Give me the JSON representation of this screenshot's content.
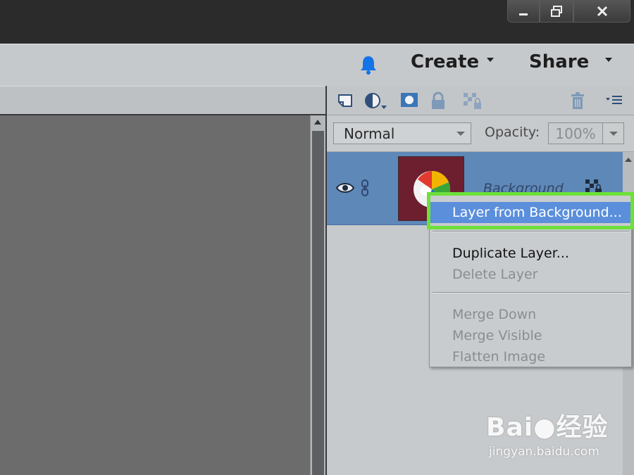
{
  "window_controls": {
    "minimize_icon": "minimize-icon",
    "restore_icon": "restore-icon",
    "close_icon": "close-icon"
  },
  "header": {
    "notification_icon": "bell-icon",
    "notification_color": "#1473e6",
    "create_label": "Create",
    "share_label": "Share"
  },
  "layers_panel": {
    "toolbar_icons": [
      "new-layer-icon",
      "adjustment-layer-icon",
      "layer-mask-icon",
      "lock-all-icon",
      "lock-transparency-icon",
      "delete-layer-icon",
      "panel-menu-icon"
    ],
    "blend_mode": "Normal",
    "opacity_label": "Opacity:",
    "opacity_value": "100%",
    "layers": [
      {
        "name": "Background",
        "visible": true,
        "selected": true,
        "thumbnail_color": "#6d1e2f"
      }
    ]
  },
  "context_menu": {
    "items": [
      {
        "label": "Layer from Background...",
        "state": "highlighted"
      },
      {
        "label": "Duplicate Layer...",
        "state": "enabled"
      },
      {
        "label": "Delete Layer",
        "state": "disabled"
      },
      {
        "label": "Merge Down",
        "state": "disabled"
      },
      {
        "label": "Merge Visible",
        "state": "disabled"
      },
      {
        "label": "Flatten Image",
        "state": "disabled"
      }
    ],
    "highlight_color": "#6de03a"
  },
  "watermark": {
    "logo": "Bai●经验",
    "url": "jingyan.baidu.com"
  }
}
